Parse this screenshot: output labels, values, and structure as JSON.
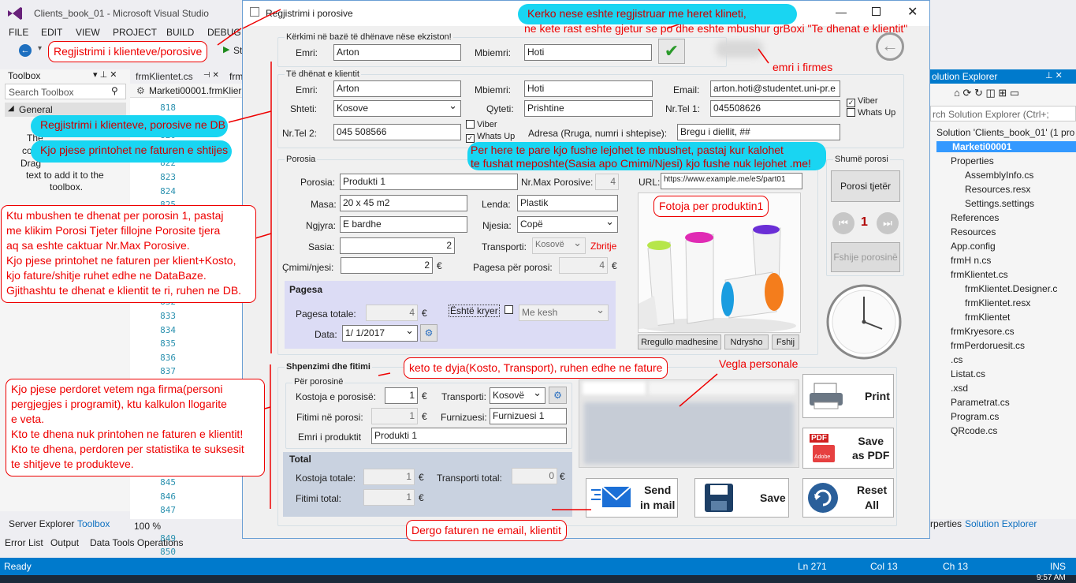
{
  "vs": {
    "title": "Clients_book_01 - Microsoft Visual Studio",
    "menu": [
      "FILE",
      "EDIT",
      "VIEW",
      "PROJECT",
      "BUILD",
      "DEBUG"
    ],
    "toolbar_tail": "St",
    "toolbox": {
      "title": "Toolbox",
      "search_placeholder": "Search Toolbox",
      "group": "General",
      "text_1": "The",
      "text_2": "con",
      "text_3": "Drag",
      "text_4": "text to add it to the",
      "text_5": "toolbox."
    },
    "editor": {
      "tab1": "frmKlientet.cs",
      "tab2": "frm",
      "file_label": "Marketi00001.frmKlier",
      "line_numbers": [
        "818",
        "819",
        "820",
        "821",
        "822",
        "823",
        "824",
        "825",
        "826",
        "827",
        "828",
        "829",
        "830",
        "831",
        "832",
        "833",
        "834",
        "835",
        "836",
        "837",
        "838",
        "839",
        "840",
        "841",
        "842",
        "843",
        "844",
        "845",
        "846",
        "847",
        "848",
        "849",
        "850"
      ],
      "zoom": "100 %"
    },
    "bottom_tabs": {
      "server_explorer": "Server Explorer",
      "toolbox": "Toolbox",
      "error_list": "Error List",
      "output": "Output",
      "data_tools": "Data Tools Operations",
      "properties": "rperties",
      "solution_explorer": "Solution Explorer"
    },
    "solution_explorer": {
      "title": "olution Explorer",
      "search_placeholder": "rch Solution Explorer (Ctrl+;",
      "items": [
        "Solution 'Clients_book_01' (1 pro",
        "Marketi00001",
        "Properties",
        "AssemblyInfo.cs",
        "Resources.resx",
        "Settings.settings",
        "References",
        "Resources",
        "App.config",
        "frmH                   n.cs",
        "frmKlientet.cs",
        "frmKlientet.Designer.c",
        "frmKlientet.resx",
        "frmKlientet",
        "frmKryesore.cs",
        "frmPerdoruesit.cs",
        "                  .cs",
        "Listat.cs",
        "                            .xsd",
        "Parametrat.cs",
        "Program.cs",
        "QRcode.cs"
      ]
    },
    "status": {
      "ready": "Ready",
      "ln": "Ln 271",
      "col": "Col 13",
      "ch": "Ch 13",
      "ins": "INS",
      "clock": "9:57 AM"
    }
  },
  "form": {
    "title": "Regjistrimi  i  porosive",
    "search": {
      "legend": "Kërkimi në bazë të dhënave nëse ekziston!",
      "emri_label": "Emri:",
      "emri": "Arton",
      "mbiemri_label": "Mbiemri:",
      "mbiemri": "Hoti"
    },
    "client": {
      "legend": "Të dhënat e klientit",
      "emri_label": "Emri:",
      "emri": "Arton",
      "mbiemri_label": "Mbiemri:",
      "mbiemri": "Hoti",
      "email_label": "Email:",
      "email": "arton.hoti@studentet.uni-pr.e",
      "shteti_label": "Shteti:",
      "shteti": "Kosove",
      "qyteti_label": "Qyteti:",
      "qyteti": "Prishtine",
      "tel1_label": "Nr.Tel 1:",
      "tel1": "045508626",
      "viber": "Viber",
      "whatsup": "Whats Up",
      "tel2_label": "Nr.Tel 2:",
      "tel2": "045 508566",
      "adresa_label": "Adresa (Rruga, numri i shtepise):",
      "adresa": "Bregu i diellit, ##"
    },
    "order": {
      "legend": "Porosia",
      "porosia_label": "Porosia:",
      "porosia": "Produkti 1",
      "maxpor_label": "Nr.Max Porosive:",
      "maxpor": "4",
      "url_label": "URL:",
      "url": "https://www.example.me/eS/part01",
      "masa_label": "Masa:",
      "masa": "20 x 45 m2",
      "lenda_label": "Lenda:",
      "lenda": "Plastik",
      "ngjyra_label": "Ngjyra:",
      "ngjyra": "E bardhe",
      "njesia_label": "Njesia:",
      "njesia": "Copë",
      "sasia_label": "Sasia:",
      "sasia": "2",
      "transporti_label": "Transporti:",
      "transporti": "Kosovë",
      "zbritje": "Zbritje",
      "cmimi_label": "Çmimi/njesi:",
      "cmimi": "2",
      "euro": "€",
      "pagesa_label": "Pagesa për porosi:",
      "pagesa": "4"
    },
    "payment": {
      "legend": "Pagesa",
      "totale_label": "Pagesa totale:",
      "totale": "4",
      "kryer_label": "Është kryer",
      "menyra": "Me kesh",
      "data_label": "Data:",
      "data": "1/  1/2017"
    },
    "image_buttons": [
      "Rregullo madhesine",
      "Ndrysho",
      "Fshij"
    ],
    "shume": {
      "legend": "Shumë porosi",
      "tjeter": "Porosi tjetër",
      "page": "1",
      "fshije": "Fshije porosinë"
    },
    "profit": {
      "legend": "Shpenzimi dhe fitimi",
      "sub": "Për porosinë",
      "kosto_label": "Kostoja e porosisë:",
      "kosto": "1",
      "transport_label": "Transporti:",
      "transport": "Kosovë",
      "fitimi_label": "Fitimi në porosi:",
      "fitimi": "1",
      "furnizuesi_label": "Furnizuesi:",
      "furnizuesi": "Furnizuesi 1",
      "emri_prod_label": "Emri i produktit",
      "emri_prod": "Produkti 1"
    },
    "total": {
      "legend": "Total",
      "kosto_label": "Kostoja totale:",
      "kosto": "1",
      "transport_label": "Transporti total:",
      "transport": "0",
      "fitimi_label": "Fitimi total:",
      "fitimi": "1"
    },
    "buttons": {
      "print": "Print",
      "pdf_1": "Save",
      "pdf_2": "as PDF",
      "send_1": "Send",
      "send_2": "in mail",
      "save": "Save",
      "reset_1": "Reset",
      "reset_2": "All",
      "pdf_icon_text": "PDF",
      "adobe": "Adobe"
    }
  },
  "annotations": {
    "reg_porosive": "Regjistrimi i klienteve/porosive",
    "kerko_1": "Kerko nese eshte regjistruar me heret klineti,",
    "kerko_2": "ne kete rast eshte gjetur se po dhe eshte mbushur grBoxi \"Te dhenat e klientit\"",
    "emri_firmes": "emri i firmes",
    "reg_db": "Regjistrimi i klienteve, porosive ne DB",
    "printohet": "Kjo pjese printohet ne faturen e shtijes",
    "per_here_1": "Per here te pare kjo fushe lejohet te mbushet, pastaj kur kalohet",
    "per_here_2": "te fushat meposhte(Sasia apo Cmimi/Njesi) kjo fushe nuk lejohet .me!",
    "fotoja": "Fotoja per produktin1",
    "ktu": [
      "Ktu mbushen te dhenat per porosin 1, pastaj",
      "me klikim Porosi Tjeter fillojne Porosite tjera",
      "aq sa eshte caktuar Nr.Max Porosive.",
      "Kjo pjese printohet ne faturen per klient+Kosto,",
      "kjo fature/shitje ruhet edhe ne DataBaze.",
      "Gjithashtu te dhenat e klientit te ri, ruhen ne DB."
    ],
    "keto": "keto te dyja(Kosto, Transport), ruhen edhe ne fature",
    "vegla": "Vegla personale",
    "firma": [
      "Kjo pjese perdoret vetem nga firma(personi",
      "pergjegjes i programit), ktu kalkulon llogarite",
      "e veta.",
      "Kto te dhena nuk printohen ne faturen e klientit!",
      "Kto te dhena, perdoren per statistika te suksesit",
      "te shitjeve te produkteve."
    ],
    "dergo": "Dergo faturen ne email, klientit"
  },
  "colors": {
    "accent": "#007acc",
    "annotation_red": "#e00000",
    "cyan": "#19d5f2",
    "send_blue": "#1b6fd6"
  }
}
